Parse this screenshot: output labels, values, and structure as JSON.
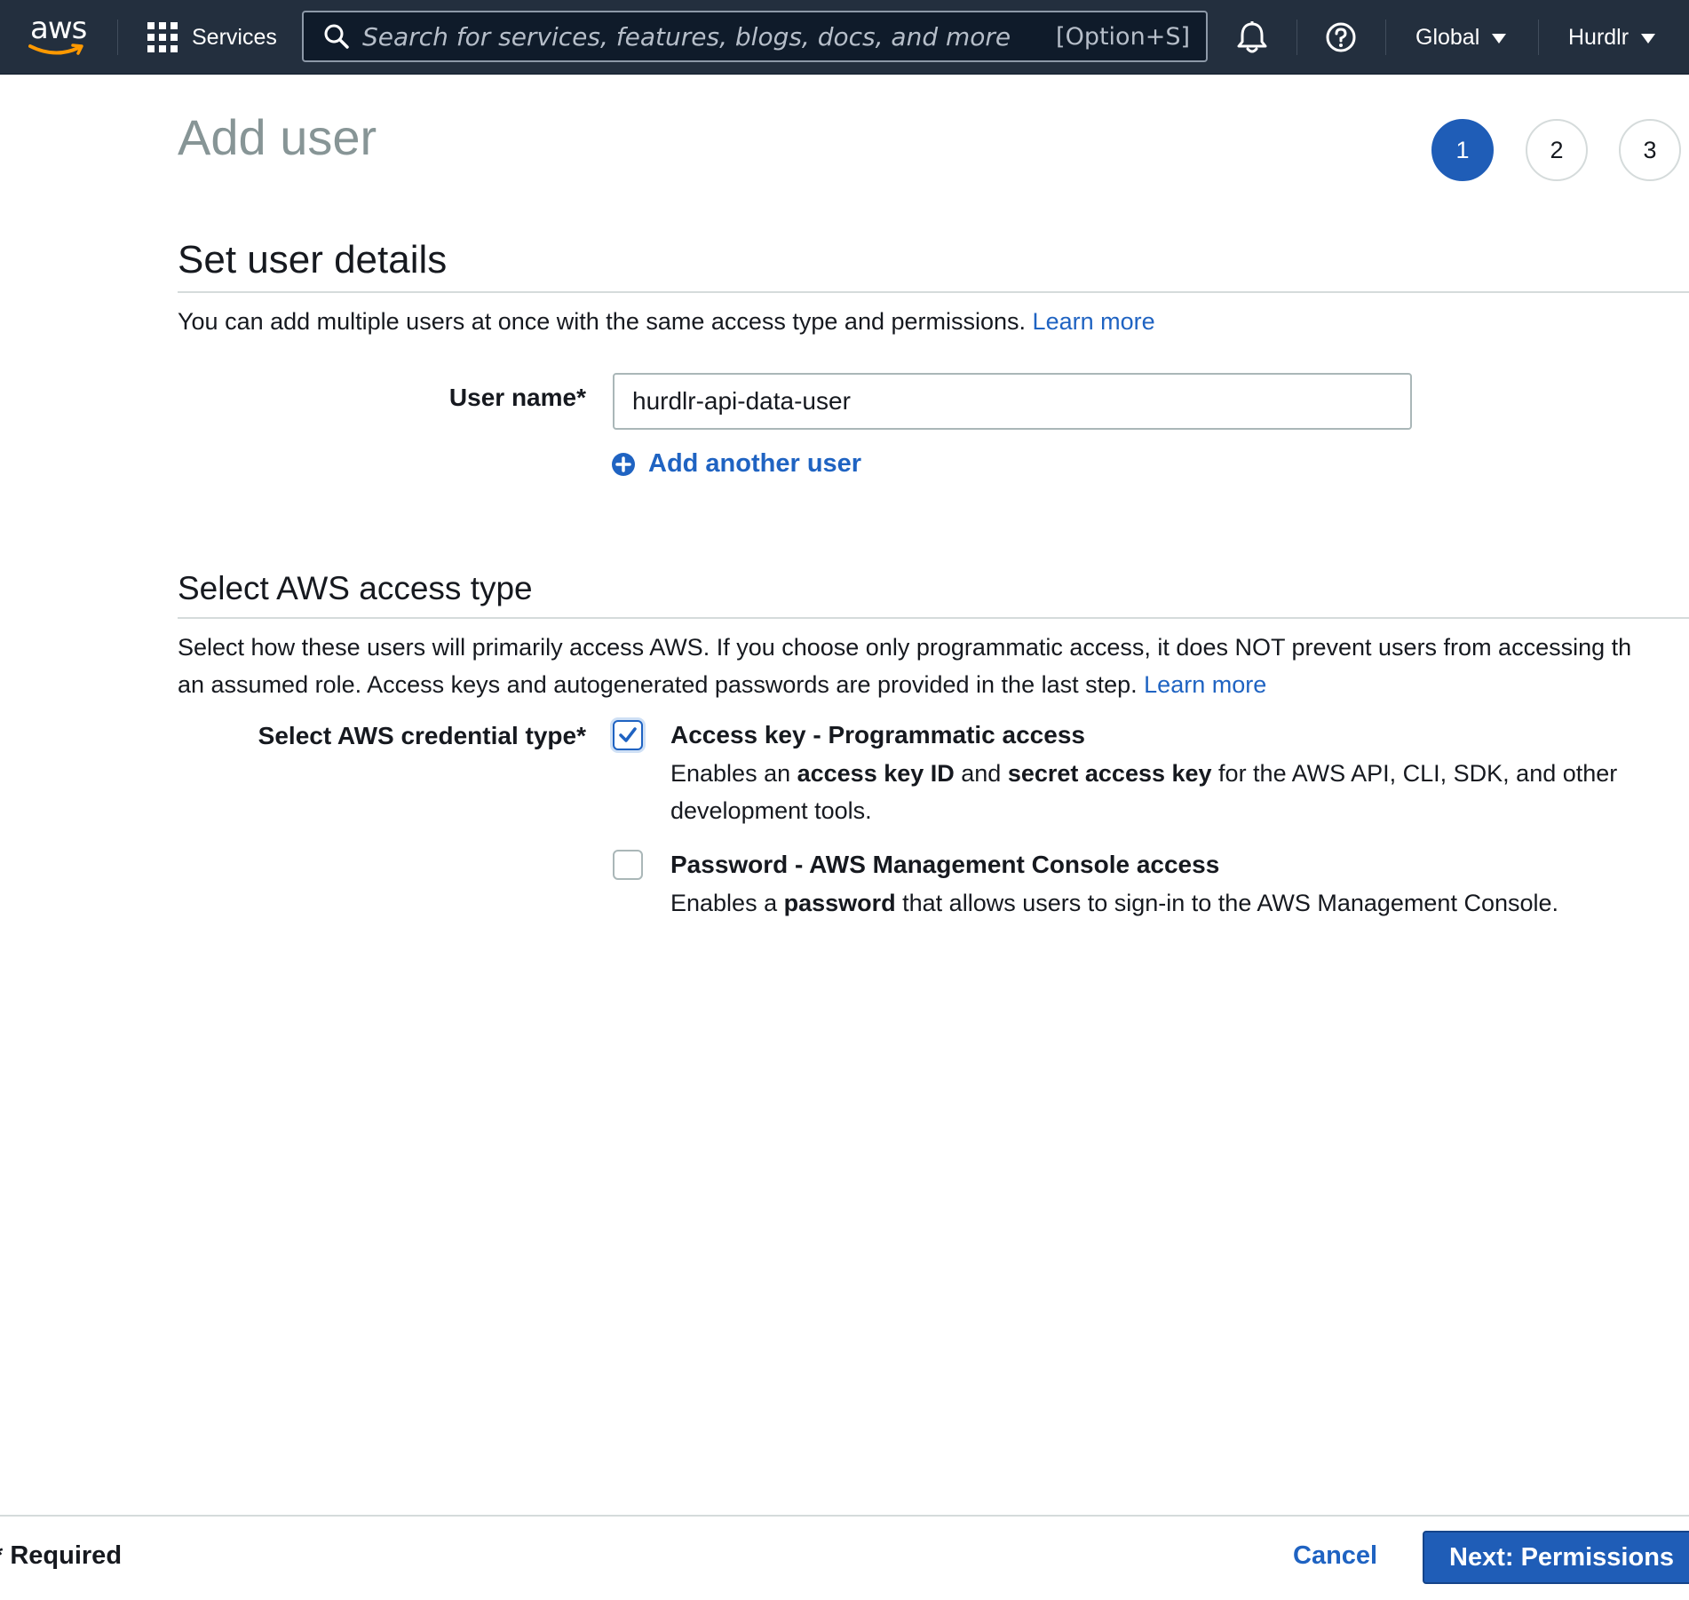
{
  "topnav": {
    "logo_text": "aws",
    "services_label": "Services",
    "search_placeholder": "Search for services, features, blogs, docs, and more",
    "search_shortcut": "[Option+S]",
    "region_label": "Global",
    "account_label": "Hurdlr",
    "icons": [
      "grid-icon",
      "search-icon",
      "bell-icon",
      "help-icon",
      "caret-down-icon"
    ]
  },
  "page": {
    "title": "Add user",
    "steps": [
      "1",
      "2",
      "3"
    ],
    "active_step": "1"
  },
  "user_details": {
    "heading": "Set user details",
    "description": "You can add multiple users at once with the same access type and permissions.",
    "learn_more": "Learn more",
    "user_name_label": "User name*",
    "user_name_value": "hurdlr-api-data-user",
    "add_another_user": "Add another user"
  },
  "access_type": {
    "heading": "Select AWS access type",
    "description_line1": "Select how these users will primarily access AWS. If you choose only programmatic access, it does NOT prevent users from accessing th",
    "description_line2": "an assumed role. Access keys and autogenerated passwords are provided in the last step.",
    "learn_more": "Learn more",
    "credential_label": "Select AWS credential type*",
    "options": [
      {
        "title": "Access key - Programmatic access",
        "checked": true,
        "desc_1": "Enables an ",
        "desc_b1": "access key ID",
        "desc_2": " and ",
        "desc_b2": "secret access key",
        "desc_3": " for the AWS API, CLI, SDK, and other development tools."
      },
      {
        "title": "Password - AWS Management Console access",
        "checked": false,
        "desc_1": "Enables a ",
        "desc_b1": "password",
        "desc_2": " that allows users to sign-in to the AWS Management Console."
      }
    ]
  },
  "footer": {
    "required_label": "* Required",
    "cancel_label": "Cancel",
    "next_label": "Next: Permissions"
  },
  "colors": {
    "nav_bg": "#232f3e",
    "primary": "#1f5db7",
    "link": "#1f63c2",
    "title_gray": "#879596"
  }
}
